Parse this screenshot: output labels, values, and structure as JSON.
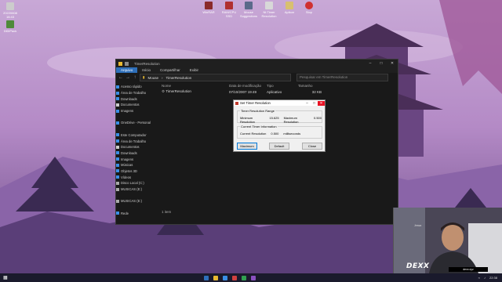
{
  "desktop_icons": [
    {
      "label": "20220608 16:43",
      "color": "#cccccc"
    },
    {
      "label": "DiDiPack",
      "color": "#4e8a3a"
    }
  ],
  "top_icons": [
    {
      "label": "WinRAR",
      "color": "#8a2a2a"
    },
    {
      "label": "RAM/CPU SSD",
      "color": "#b03030"
    },
    {
      "label": "Mouse Suggestions",
      "color": "#5a6a8a"
    },
    {
      "label": "Nt Timer Resolution",
      "color": "#d8d8d8"
    },
    {
      "label": "Aplicar",
      "color": "#d8c070"
    },
    {
      "label": "Stop",
      "color": "#d03030"
    }
  ],
  "explorer": {
    "title": "TimerResolution",
    "tabs": [
      "Arquivo",
      "Início",
      "Compartilhar",
      "Exibir"
    ],
    "breadcrumb": [
      "Mouse",
      "TimerResolution"
    ],
    "search_placeholder": "Pesquisar em TimerResolution",
    "columns": [
      "Nome",
      "Data de modificação",
      "Tipo",
      "Tamanho"
    ],
    "files": [
      {
        "name": "TimerResolution",
        "date": "07/10/2007 19:49",
        "type": "Aplicativo",
        "size": "32 KB"
      }
    ],
    "nav_items": [
      {
        "label": "Acesso rápido",
        "color": "#3a8ee6"
      },
      {
        "label": "Área de Trabalho",
        "color": "#3a8ee6"
      },
      {
        "label": "Downloads",
        "color": "#3a8ee6"
      },
      {
        "label": "Documentos",
        "color": "#cccccc"
      },
      {
        "label": "Imagens",
        "color": "#3a8ee6"
      },
      {
        "label": "",
        "color": "transparent"
      },
      {
        "label": "OneDrive - Personal",
        "color": "#3a8ee6"
      },
      {
        "label": "",
        "color": "transparent"
      },
      {
        "label": "Este Computador",
        "color": "#3a8ee6"
      },
      {
        "label": "Área de Trabalho",
        "color": "#3a8ee6"
      },
      {
        "label": "Documentos",
        "color": "#cccccc"
      },
      {
        "label": "Downloads",
        "color": "#3a8ee6"
      },
      {
        "label": "Imagens",
        "color": "#3a8ee6"
      },
      {
        "label": "Músicas",
        "color": "#3a8ee6"
      },
      {
        "label": "Objetos 3D",
        "color": "#3a8ee6"
      },
      {
        "label": "Vídeos",
        "color": "#3a8ee6"
      },
      {
        "label": "Disco Local (C:)",
        "color": "#aaaaaa"
      },
      {
        "label": "MUSICAS (E:)",
        "color": "#aaaaaa"
      },
      {
        "label": "",
        "color": "transparent"
      },
      {
        "label": "MUSICAS (E:)",
        "color": "#aaaaaa"
      },
      {
        "label": "",
        "color": "transparent"
      },
      {
        "label": "Rede",
        "color": "#3a8ee6"
      }
    ],
    "status": "1 item"
  },
  "dialog": {
    "title": "Set Timer Resolution",
    "range_group": "Timer Resolution Range",
    "min_label": "Minimum Resolution",
    "min_value": "15.625",
    "max_label": "Maximum Resolution",
    "max_value": "0.500",
    "info_group": "Current Timer Information",
    "current_label": "Current Resolution",
    "current_value": "0.500",
    "current_unit": "milliseconds",
    "btn_maximum": "Maximum",
    "btn_default": "Default",
    "btn_close": "Close"
  },
  "webcam": {
    "name": "DEXX",
    "tag": "dexx.xyz",
    "label": "Jessa"
  },
  "taskbar": {
    "clock": "22:38",
    "icons": [
      "#2e6fba",
      "#e8b931",
      "#3a8ee6",
      "#d04040",
      "#30a050",
      "#8a50c0"
    ]
  }
}
